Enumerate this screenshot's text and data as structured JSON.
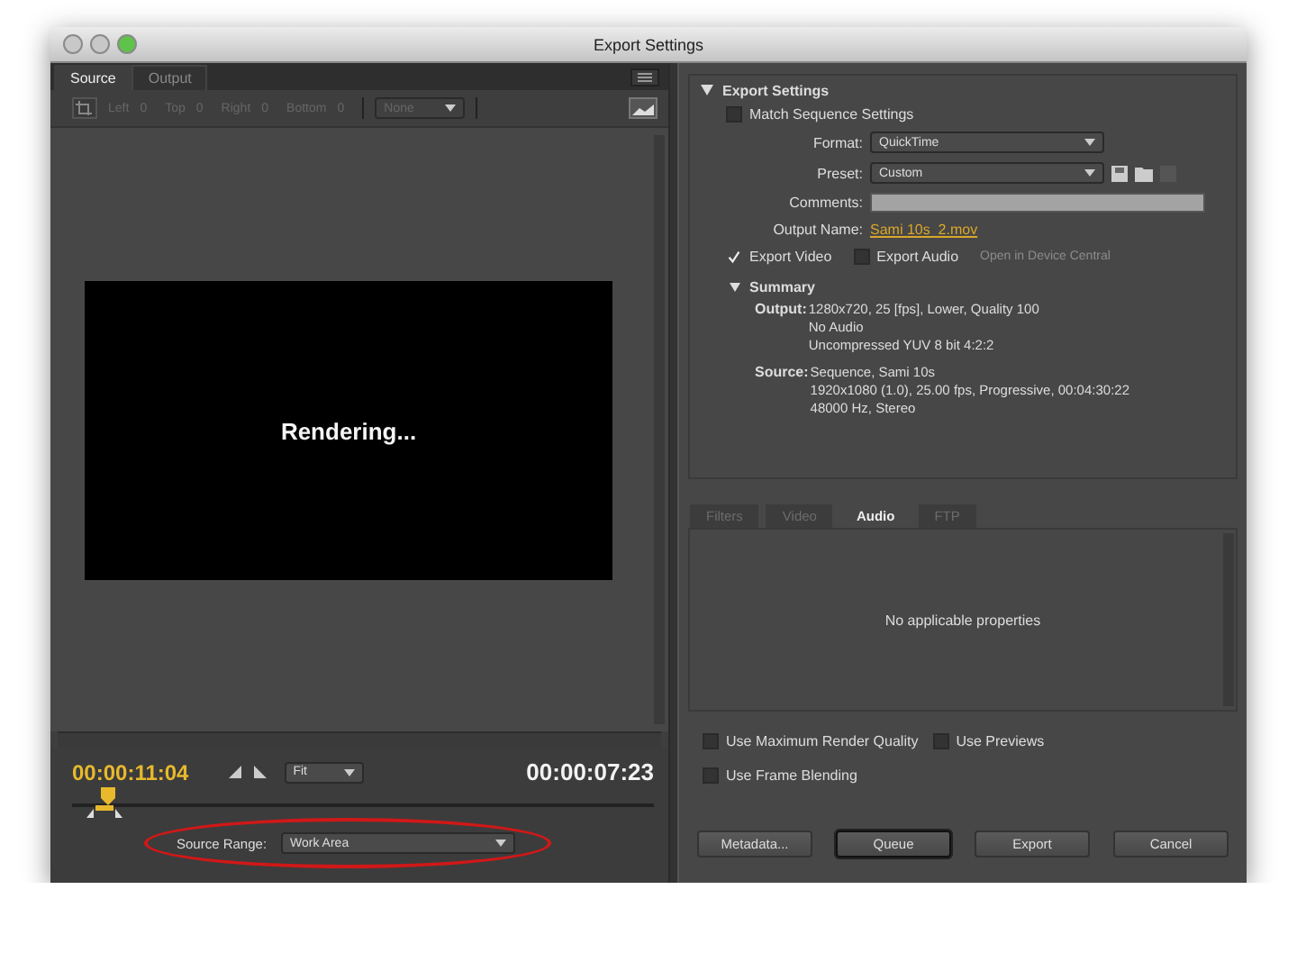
{
  "window": {
    "title": "Export Settings"
  },
  "source_panel": {
    "tabs": [
      {
        "label": "Source",
        "selected": true
      },
      {
        "label": "Output",
        "selected": false
      }
    ],
    "crop": [
      {
        "label": "Left",
        "value": "0"
      },
      {
        "label": "Top",
        "value": "0"
      },
      {
        "label": "Right",
        "value": "0"
      },
      {
        "label": "Bottom",
        "value": "0"
      }
    ],
    "aspect": "None",
    "preview_text": "Rendering...",
    "current_time": "00:00:11:04",
    "zoom": "Fit",
    "duration": "00:00:07:23",
    "playhead": {
      "level": 0.05
    },
    "source_range": {
      "label": "Source Range:",
      "value": "Work Area"
    }
  },
  "export_settings": {
    "heading": "Export Settings",
    "expanded": true,
    "match_sequence": {
      "label": "Match Sequence Settings",
      "checked": false
    },
    "fields": [
      {
        "kind": "dropdown",
        "label": "Format:",
        "value": "QuickTime"
      },
      {
        "kind": "dropdown",
        "label": "Preset:",
        "value": "Custom"
      },
      {
        "kind": "text",
        "label": "Comments:"
      },
      {
        "kind": "link",
        "label": "Output Name:",
        "value": "Sami 10s_2.mov"
      }
    ],
    "export_options": [
      {
        "label": "Export Video",
        "checked": true
      },
      {
        "label": "Export Audio",
        "checked": false
      }
    ],
    "device_central": {
      "label": "Open in Device Central",
      "disabled": true
    },
    "summary": {
      "heading": "Summary",
      "expanded": true,
      "groups": [
        {
          "label": "Output:",
          "lines": [
            "1280x720, 25 [fps], Lower, Quality 100",
            "No Audio",
            "Uncompressed YUV 8 bit 4:2:2"
          ]
        },
        {
          "label": "Source:",
          "lines": [
            "Sequence, Sami 10s",
            "1920x1080 (1.0), 25.00 fps, Progressive, 00:04:30:22",
            "48000 Hz, Stereo"
          ]
        }
      ]
    }
  },
  "settings_tabs": [
    {
      "label": "Filters",
      "selected": false
    },
    {
      "label": "Video",
      "selected": false
    },
    {
      "label": "Audio",
      "selected": true
    },
    {
      "label": "FTP",
      "selected": false
    }
  ],
  "tab_message": "No applicable properties",
  "render_options": [
    {
      "label": "Use Maximum Render Quality",
      "checked": false
    },
    {
      "label": "Use Previews",
      "checked": false
    },
    {
      "label": "Use Frame Blending",
      "checked": false
    }
  ],
  "buttons": [
    {
      "label": "Metadata...",
      "default": false
    },
    {
      "label": "Queue",
      "default": true
    },
    {
      "label": "Export",
      "default": false
    },
    {
      "label": "Cancel",
      "default": false
    }
  ]
}
